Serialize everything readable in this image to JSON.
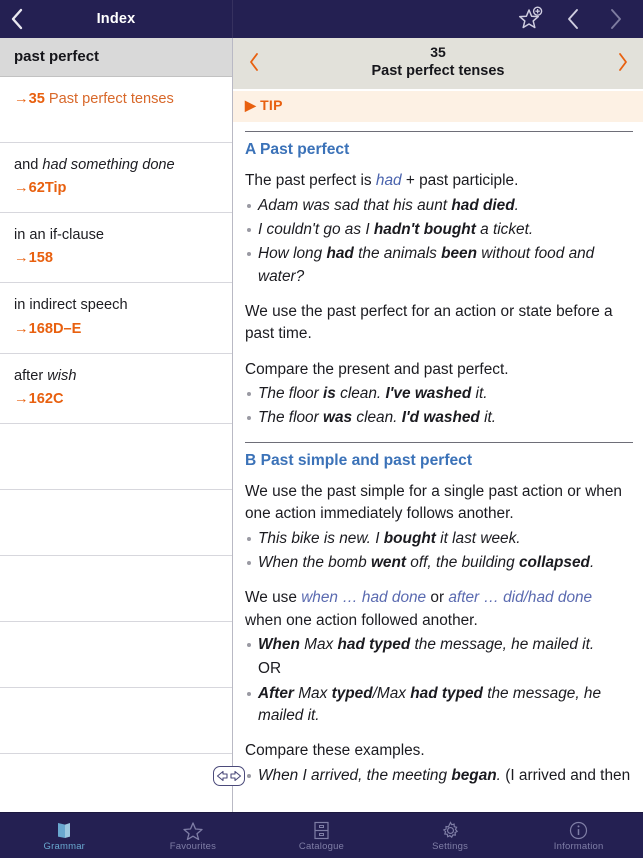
{
  "topbar": {
    "back_icon": "chevron-left-icon",
    "title": "Index",
    "favourite_icon": "star-add-icon",
    "prev_icon": "chevron-left-icon",
    "next_icon": "chevron-right-icon"
  },
  "sidebar": {
    "header": "past perfect",
    "rows": [
      {
        "kind": "ref-line",
        "ref": "→35",
        "label": "Past perfect tenses"
      },
      {
        "kind": "entry",
        "title_plain": "and ",
        "title_italic": "had something done",
        "ref": "→62Tip"
      },
      {
        "kind": "entry",
        "title_plain": "in an if-clause",
        "title_italic": "",
        "ref": "→158"
      },
      {
        "kind": "entry",
        "title_plain": "in indirect speech",
        "title_italic": "",
        "ref": "→168D–E"
      },
      {
        "kind": "entry",
        "title_plain": "after ",
        "title_italic": "wish",
        "ref": "→162C"
      },
      {
        "kind": "blank"
      },
      {
        "kind": "blank"
      },
      {
        "kind": "blank"
      },
      {
        "kind": "blank"
      },
      {
        "kind": "blank"
      },
      {
        "kind": "blank"
      }
    ]
  },
  "page_nav": {
    "prev_icon": "chevron-left-icon",
    "next_icon": "chevron-right-icon",
    "number": "35",
    "subtitle": "Past perfect tenses"
  },
  "tip_bar": {
    "marker": "▶",
    "label": "TIP"
  },
  "article": {
    "section_a": {
      "heading": "A Past perfect",
      "intro_1": "The past perfect is ",
      "intro_link": "had",
      "intro_2": " + past participle.",
      "examples_1": [
        "Adam was sad that his aunt had died.",
        "I couldn't go as I hadn't bought a ticket.",
        "How long had the animals been without food and water?"
      ],
      "para_use": "We use the past perfect for an action or state before a past time.",
      "para_compare": "Compare the present and past perfect.",
      "examples_2": [
        "The floor is clean. I've washed it.",
        "The floor was clean. I'd washed it."
      ]
    },
    "section_b": {
      "heading": "B Past simple and past perfect",
      "para_use": "We use the past simple for a single past action or when one action immediately follows another.",
      "examples_1": [
        "This bike is new. I bought it last week.",
        "When the bomb went off, the building collapsed."
      ],
      "para_link_1": "We use ",
      "link_a": "when … had done",
      "para_link_2": " or ",
      "link_b": "after … did/had done",
      "para_link_3": " when one action followed another.",
      "examples_2": [
        "When Max had typed the message, he mailed it.",
        "OR",
        "After Max typed/Max had typed the message, he mailed it."
      ],
      "para_compare": "Compare these examples.",
      "examples_3": [
        "When I arrived, the meeting began. (I arrived and then"
      ]
    }
  },
  "drag_handle": {
    "icon": "resize-horizontal-icon"
  },
  "tabbar": {
    "tabs": [
      {
        "label": "Grammar",
        "icon": "book-icon",
        "active": true
      },
      {
        "label": "Favourites",
        "icon": "star-icon",
        "active": false
      },
      {
        "label": "Catalogue",
        "icon": "drawers-icon",
        "active": false
      },
      {
        "label": "Settings",
        "icon": "gear-icon",
        "active": false
      },
      {
        "label": "Information",
        "icon": "info-icon",
        "active": false
      }
    ]
  },
  "colors": {
    "navy": "#242052",
    "orange": "#e8600f",
    "blue_heading": "#3b72b8",
    "link_blue": "#4a63ad",
    "tab_active": "#69a8cf",
    "tip_bg": "#fdf1e4",
    "page_nav_bg": "#e2e1da"
  }
}
